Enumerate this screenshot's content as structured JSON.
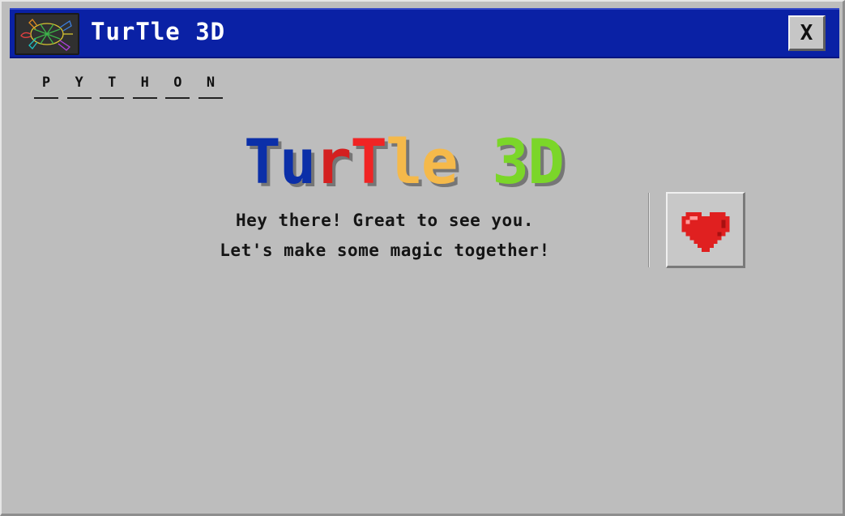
{
  "window": {
    "title": "TurTle 3D",
    "close_label": "X",
    "icon": "turtle-wireframe-icon"
  },
  "letters": [
    "P",
    "Y",
    "T",
    "H",
    "O",
    "N"
  ],
  "logo": {
    "parts": [
      {
        "text": "Tu",
        "color": "#0b2fa8"
      },
      {
        "text": "r",
        "color": "#d42020"
      },
      {
        "text": "T",
        "color": "#f02424"
      },
      {
        "text": "le",
        "color": "#f5b94a"
      },
      {
        "text": " ",
        "color": "#000000"
      },
      {
        "text": "3D",
        "color": "#7bd629"
      }
    ]
  },
  "greeting": {
    "line1": "Hey there! Great to see you.",
    "line2": "Let's make some magic together!"
  },
  "heart_button": {
    "icon": "heart-icon",
    "color": "#e02020"
  },
  "colors": {
    "titlebar": "#0a21a5",
    "window": "#bdbdbd"
  }
}
